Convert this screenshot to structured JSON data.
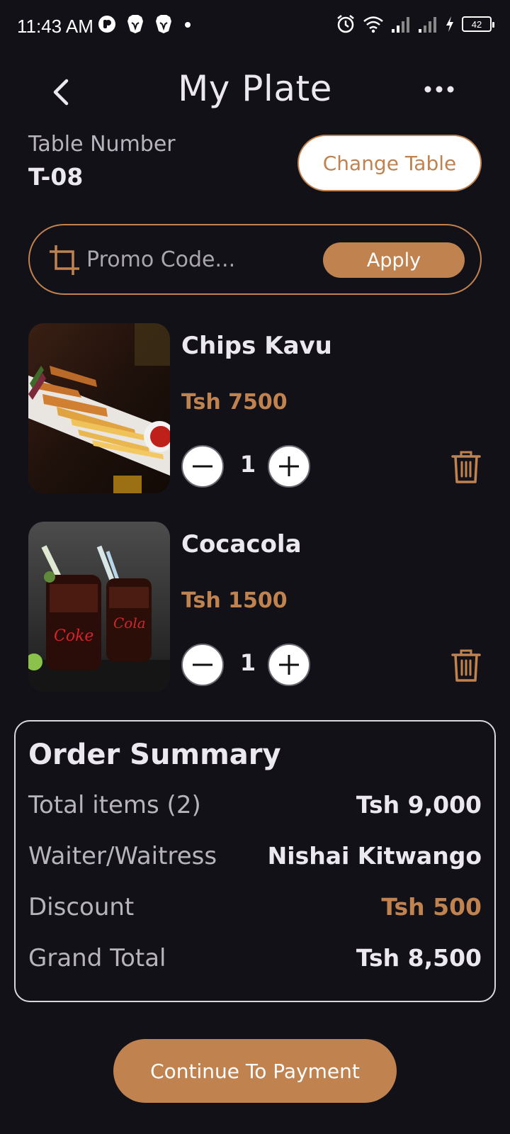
{
  "status_bar": {
    "time": "11:43 AM",
    "battery": "42",
    "left_icons": [
      "app-icon",
      "brave-lion-icon",
      "brave-lion-icon",
      "dot-icon"
    ],
    "right_icons": [
      "alarm-icon",
      "wifi-icon",
      "signal-icon",
      "signal-icon",
      "charging-icon"
    ]
  },
  "header": {
    "title": "My Plate",
    "back_icon": "chevron-left-icon",
    "more_icon": "more-dots-icon"
  },
  "table": {
    "label": "Table Number",
    "value": "T-08",
    "change_button": "Change Table"
  },
  "promo": {
    "placeholder": "Promo Code...",
    "value": "",
    "icon": "crop-icon",
    "apply_button": "Apply"
  },
  "cart_items": [
    {
      "name": "Chips Kavu",
      "price": "Tsh 7500",
      "quantity": "1",
      "image": "fried-chicken-fries-photo"
    },
    {
      "name": "Cocacola",
      "price": "Tsh 1500",
      "quantity": "1",
      "image": "coca-cola-glasses-photo"
    }
  ],
  "summary": {
    "title": "Order Summary",
    "rows": [
      {
        "label": "Total items (2)",
        "value": "Tsh 9,000"
      },
      {
        "label": "Waiter/Waitress",
        "value": "Nishai Kitwango"
      },
      {
        "label": "Discount",
        "value": "Tsh 500"
      },
      {
        "label": "Grand Total",
        "value": "Tsh 8,500"
      }
    ]
  },
  "continue_button": "Continue To Payment",
  "colors": {
    "background": "#131118",
    "accent": "#c0824f",
    "text": "#ece9ee",
    "muted_text": "#b7b4bb"
  }
}
